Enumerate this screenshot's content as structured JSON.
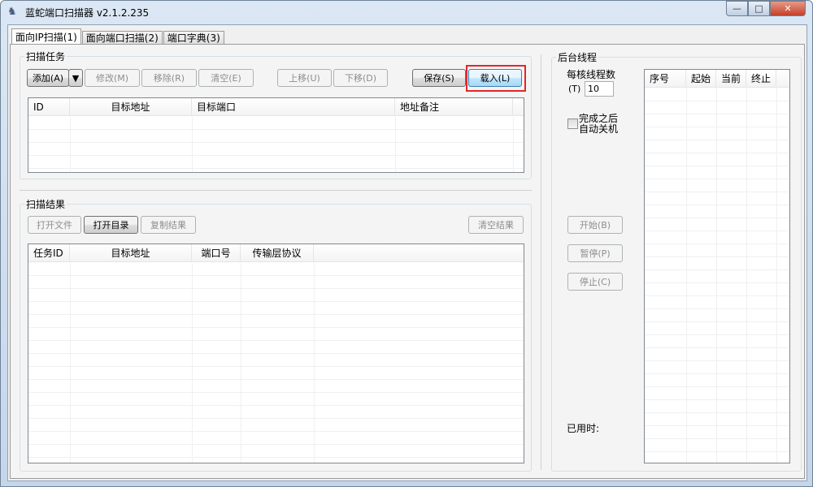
{
  "window": {
    "title": "蓝蛇端口扫描器 v2.1.2.235",
    "minimize": "—",
    "maximize": "□",
    "close": "✕"
  },
  "tabs": [
    {
      "label": "面向IP扫描(1)"
    },
    {
      "label": "面向端口扫描(2)"
    },
    {
      "label": "端口字典(3)"
    }
  ],
  "scan_task": {
    "title": "扫描任务",
    "add": "添加(A)",
    "dropdown": "▼",
    "edit": "修改(M)",
    "remove": "移除(R)",
    "clear": "清空(E)",
    "up": "上移(U)",
    "down": "下移(D)",
    "save": "保存(S)",
    "load": "载入(L)",
    "columns": [
      "ID",
      "目标地址",
      "目标端口",
      "地址备注"
    ]
  },
  "scan_result": {
    "title": "扫描结果",
    "open_file": "打开文件",
    "open_dir": "打开目录",
    "copy": "复制结果",
    "clear": "清空结果",
    "columns": [
      "任务ID",
      "目标地址",
      "端口号",
      "传输层协议"
    ]
  },
  "threads": {
    "title": "后台线程",
    "per_core": "每核线程数",
    "t_label": "(T)",
    "t_value": "10",
    "shutdown": "完成之后自动关机",
    "start": "开始(B)",
    "pause": "暂停(P)",
    "stop": "停止(C)",
    "elapsed": "已用时:",
    "columns": [
      "序号",
      "起始",
      "当前",
      "终止"
    ]
  }
}
